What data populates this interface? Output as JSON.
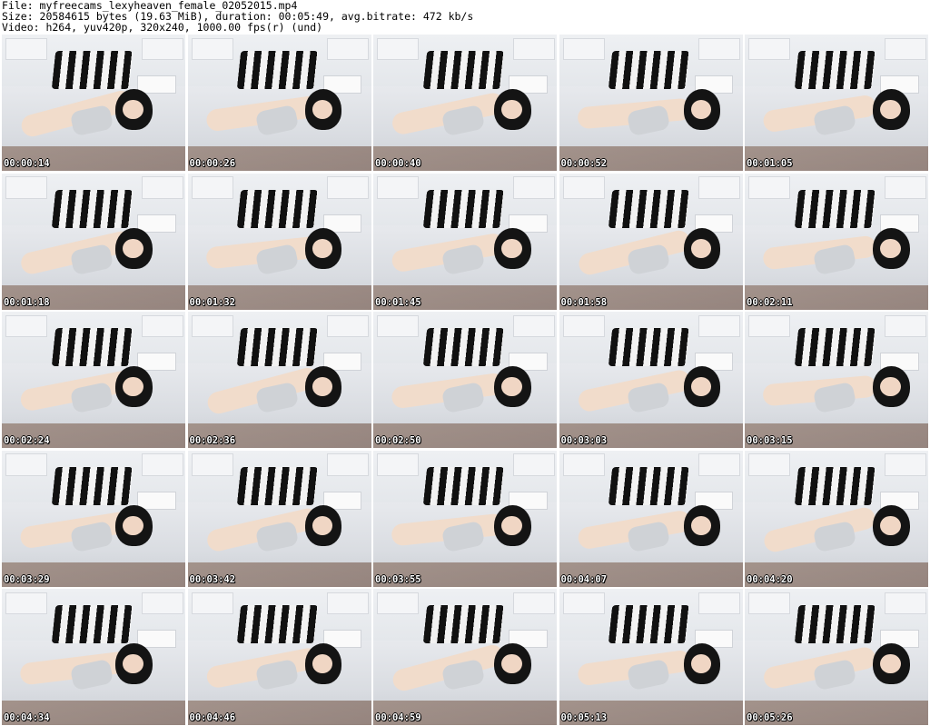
{
  "header": {
    "file_line": "File: myfreecams_lexyheaven_female_02052015.mp4",
    "size_line": "Size: 20584615 bytes (19.63 MiB), duration: 00:05:49, avg.bitrate: 472 kb/s",
    "video_line": "Video: h264, yuv420p, 320x240, 1000.00 fps(r) (und)"
  },
  "thumbnails": [
    {
      "timestamp": "00:00:14"
    },
    {
      "timestamp": "00:00:26"
    },
    {
      "timestamp": "00:00:40"
    },
    {
      "timestamp": "00:00:52"
    },
    {
      "timestamp": "00:01:05"
    },
    {
      "timestamp": "00:01:18"
    },
    {
      "timestamp": "00:01:32"
    },
    {
      "timestamp": "00:01:45"
    },
    {
      "timestamp": "00:01:58"
    },
    {
      "timestamp": "00:02:11"
    },
    {
      "timestamp": "00:02:24"
    },
    {
      "timestamp": "00:02:36"
    },
    {
      "timestamp": "00:02:50"
    },
    {
      "timestamp": "00:03:03"
    },
    {
      "timestamp": "00:03:15"
    },
    {
      "timestamp": "00:03:29"
    },
    {
      "timestamp": "00:03:42"
    },
    {
      "timestamp": "00:03:55"
    },
    {
      "timestamp": "00:04:07"
    },
    {
      "timestamp": "00:04:20"
    },
    {
      "timestamp": "00:04:34"
    },
    {
      "timestamp": "00:04:46"
    },
    {
      "timestamp": "00:04:59"
    },
    {
      "timestamp": "00:05:13"
    },
    {
      "timestamp": "00:05:26"
    }
  ]
}
